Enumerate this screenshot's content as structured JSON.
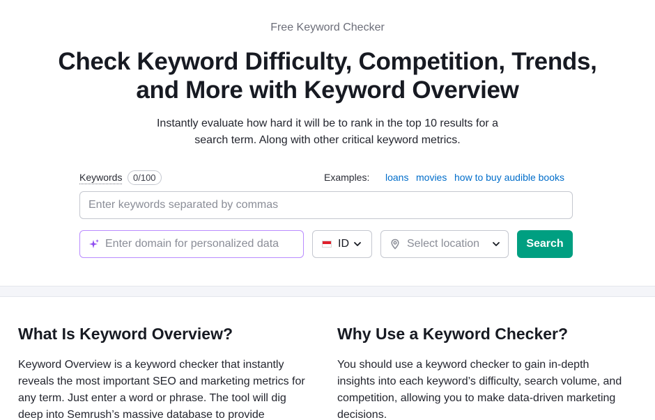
{
  "hero": {
    "eyebrow": "Free Keyword Checker",
    "title_line1": "Check Keyword Difficulty, Competition, Trends,",
    "title_line2": "and More with Keyword Overview",
    "subtitle_line1": "Instantly evaluate how hard it will be to rank in the top 10 results for a",
    "subtitle_line2": "search term. Along with other critical keyword metrics."
  },
  "form": {
    "keywords_label": "Keywords",
    "keywords_counter": "0/100",
    "examples_label": "Examples:",
    "examples": [
      "loans",
      "movies",
      "how to buy audible books"
    ],
    "keywords_placeholder": "Enter keywords separated by commas",
    "domain_placeholder": "Enter domain for personalized data",
    "database_code": "ID",
    "location_placeholder": "Select location",
    "search_label": "Search",
    "icons": {
      "sparkle": "sparkle-icon",
      "flag": "indonesia-flag-icon",
      "pin": "location-pin-icon",
      "chevron": "chevron-down-icon"
    },
    "colors": {
      "accent_button": "#009f81",
      "domain_border": "#b98bff",
      "link": "#006dca",
      "flag_red": "#e0202c"
    }
  },
  "sections": {
    "left_heading": "What Is Keyword Overview?",
    "left_body": "Keyword Overview is a keyword checker that instantly reveals the most important SEO and marketing metrics for any term. Just enter a word or phrase. The tool will dig deep into Semrush’s massive database to provide",
    "right_heading": "Why Use a Keyword Checker?",
    "right_body": "You should use a keyword checker to gain in-depth insights into each keyword’s difficulty, search volume, and competition, allowing you to make data-driven marketing decisions."
  }
}
